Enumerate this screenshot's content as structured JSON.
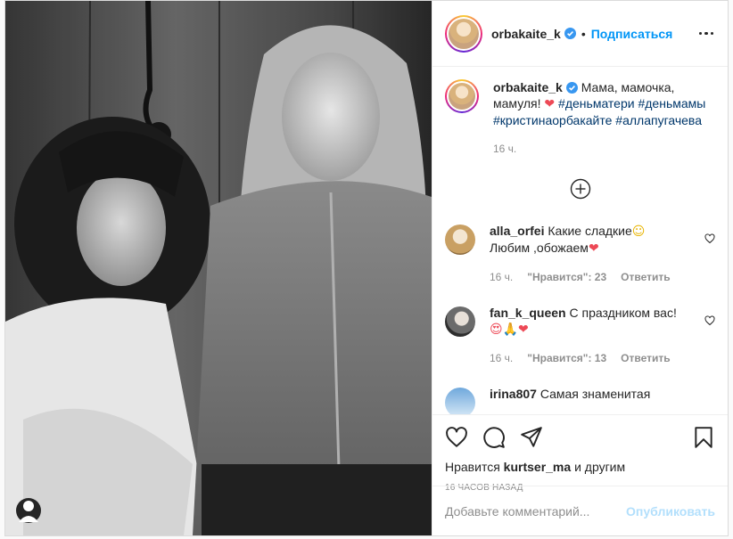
{
  "post": {
    "username": "orbakaite_k",
    "follow_label": "Подписаться",
    "dot": "•"
  },
  "caption": {
    "username": "orbakaite_k",
    "text": "Мама, мамочка, мамуля!",
    "heart": "❤",
    "hashtags": [
      "#деньматери",
      "#деньмамы",
      "#кристинаорбакайте",
      "#аллапугачева"
    ],
    "age": "16 ч."
  },
  "comments": [
    {
      "username": "alla_orfei",
      "text": "Какие сладкие",
      "emoji1": "☺",
      "text2": "Любим ,обожаем",
      "emoji2": "❤",
      "age": "16 ч.",
      "likes": "\"Нравится\": 23",
      "reply": "Ответить"
    },
    {
      "username": "fan_k_queen",
      "text": "С праздником вас!",
      "emoji_line": "😍🙏❤",
      "age": "16 ч.",
      "likes": "\"Нравится\": 13",
      "reply": "Ответить"
    },
    {
      "username": "irina807",
      "text": "Самая знаменитая"
    }
  ],
  "likes_line": {
    "prefix": "Нравится",
    "user": "kurtser_ma",
    "suffix": "и другим"
  },
  "timestamp": "16 ЧАСОВ НАЗАД",
  "add_comment": {
    "placeholder": "Добавьте комментарий...",
    "publish": "Опубликовать"
  },
  "colors": {
    "link_blue": "#0095f6",
    "hashtag": "#00376b",
    "muted": "#8e8e8e",
    "publish_disabled": "#b2dffc",
    "heart_red": "#ed4956"
  },
  "icons": [
    "tag-icon",
    "verified-icon",
    "more-icon",
    "add-comment-icon",
    "heart-icon",
    "comment-icon",
    "share-icon",
    "bookmark-icon"
  ]
}
